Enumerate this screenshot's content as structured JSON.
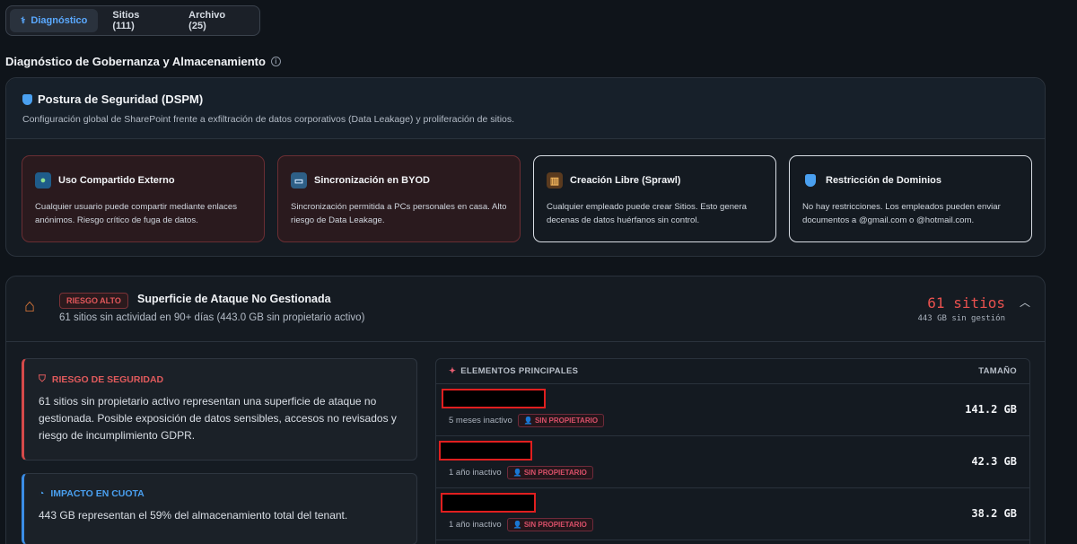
{
  "tabs": [
    {
      "label": "Diagnóstico",
      "active": true
    },
    {
      "label": "Sitios (111)",
      "active": false
    },
    {
      "label": "Archivo (25)",
      "active": false
    }
  ],
  "page_title": "Diagnóstico de Gobernanza y Almacenamiento",
  "dspm": {
    "title": "Postura de Seguridad (DSPM)",
    "subtitle": "Configuración global de SharePoint frente a exfiltración de datos corporativos (Data Leakage) y proliferación de sitios.",
    "cards": [
      {
        "title": "Uso Compartido Externo",
        "desc": "Cualquier usuario puede compartir mediante enlaces anónimos. Riesgo crítico de fuga de datos.",
        "icon": "globe-icon",
        "status": "danger"
      },
      {
        "title": "Sincronización en BYOD",
        "desc": "Sincronización permitida a PCs personales en casa. Alto riesgo de Data Leakage.",
        "icon": "laptop-icon",
        "status": "danger"
      },
      {
        "title": "Creación Libre (Sprawl)",
        "desc": "Cualquier empleado puede crear Sitios. Esto genera decenas de datos huérfanos sin control.",
        "icon": "building-icon",
        "status": "normal"
      },
      {
        "title": "Restricción de Dominios",
        "desc": "No hay restricciones. Los empleados pueden enviar documentos a @gmail.com o @hotmail.com.",
        "icon": "shield-icon",
        "status": "normal"
      }
    ]
  },
  "risk": {
    "badge": "RIESGO ALTO",
    "title": "Superficie de Ataque No Gestionada",
    "subtitle": "61 sitios sin actividad en 90+ días (443.0 GB sin propietario activo)",
    "count": "61 sitios",
    "count_sub": "443 GB sin gestión",
    "security": {
      "title": "RIESGO DE SEGURIDAD",
      "text": "61 sitios sin propietario activo representan una superficie de ataque no gestionada. Posible exposición de datos sensibles, accesos no revisados y riesgo de incumplimiento GDPR."
    },
    "quota": {
      "title": "IMPACTO EN CUOTA",
      "text": "443 GB representan el 59% del almacenamiento total del tenant."
    },
    "elements": {
      "header": "ELEMENTOS PRINCIPALES",
      "size_header": "TAMAÑO",
      "rows": [
        {
          "inactive": "5 meses inactivo",
          "badge": "SIN PROPIETARIO",
          "size": "141.2 GB"
        },
        {
          "inactive": "1 año inactivo",
          "badge": "SIN PROPIETARIO",
          "size": "42.3 GB"
        },
        {
          "inactive": "1 año inactivo",
          "badge": "SIN PROPIETARIO",
          "size": "38.2 GB"
        }
      ]
    }
  },
  "colors": {
    "accent": "#5aa9ff",
    "danger": "#e8514e",
    "info": "#4aa0f0"
  }
}
